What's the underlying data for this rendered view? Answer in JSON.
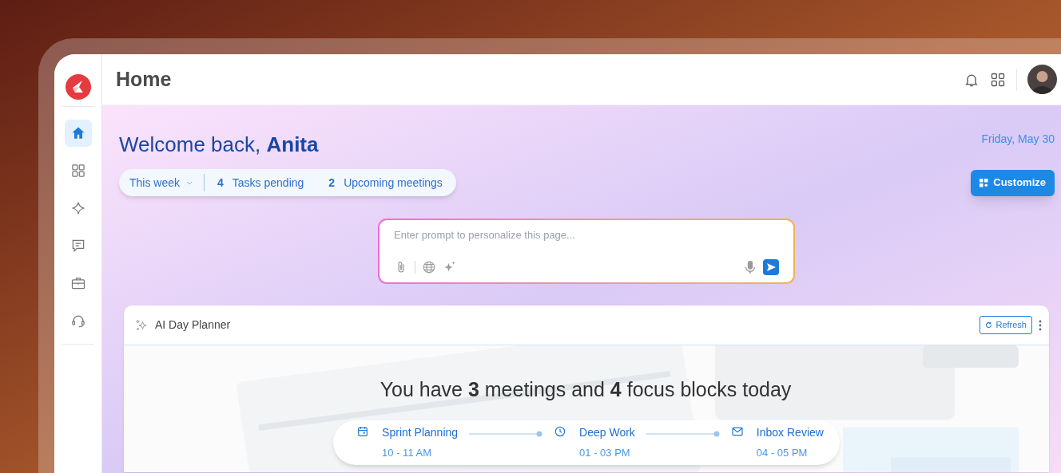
{
  "sidebar": {
    "items": [
      {
        "kind": "home",
        "selected": true
      },
      {
        "kind": "grid",
        "selected": false
      },
      {
        "kind": "sparkle",
        "selected": false
      },
      {
        "kind": "chat",
        "selected": false
      },
      {
        "kind": "briefcase",
        "selected": false
      },
      {
        "kind": "headset",
        "selected": false
      }
    ]
  },
  "header": {
    "title": "Home"
  },
  "welcome": {
    "greeting": "Welcome back, **Anita**",
    "date": "Friday, May 30"
  },
  "summary": {
    "period": "This week",
    "stats": [
      {
        "count": "4",
        "label": "Tasks pending"
      },
      {
        "count": "2",
        "label": "Upcoming meetings"
      }
    ]
  },
  "customize_button": "Customize",
  "prompt": {
    "placeholder": "Enter prompt to personalize this page..."
  },
  "planner": {
    "title": "AI Day Planner",
    "refresh": "Refresh",
    "headline": "You have **3** meetings and **4** focus blocks today",
    "schedule": [
      {
        "kind": "calendar",
        "title": "Sprint Planning",
        "time": "10 - 11 AM"
      },
      {
        "kind": "clock",
        "title": "Deep Work",
        "time": "01 - 03 PM"
      },
      {
        "kind": "mail",
        "title": "Inbox Review",
        "time": "04 - 05 PM"
      }
    ]
  }
}
